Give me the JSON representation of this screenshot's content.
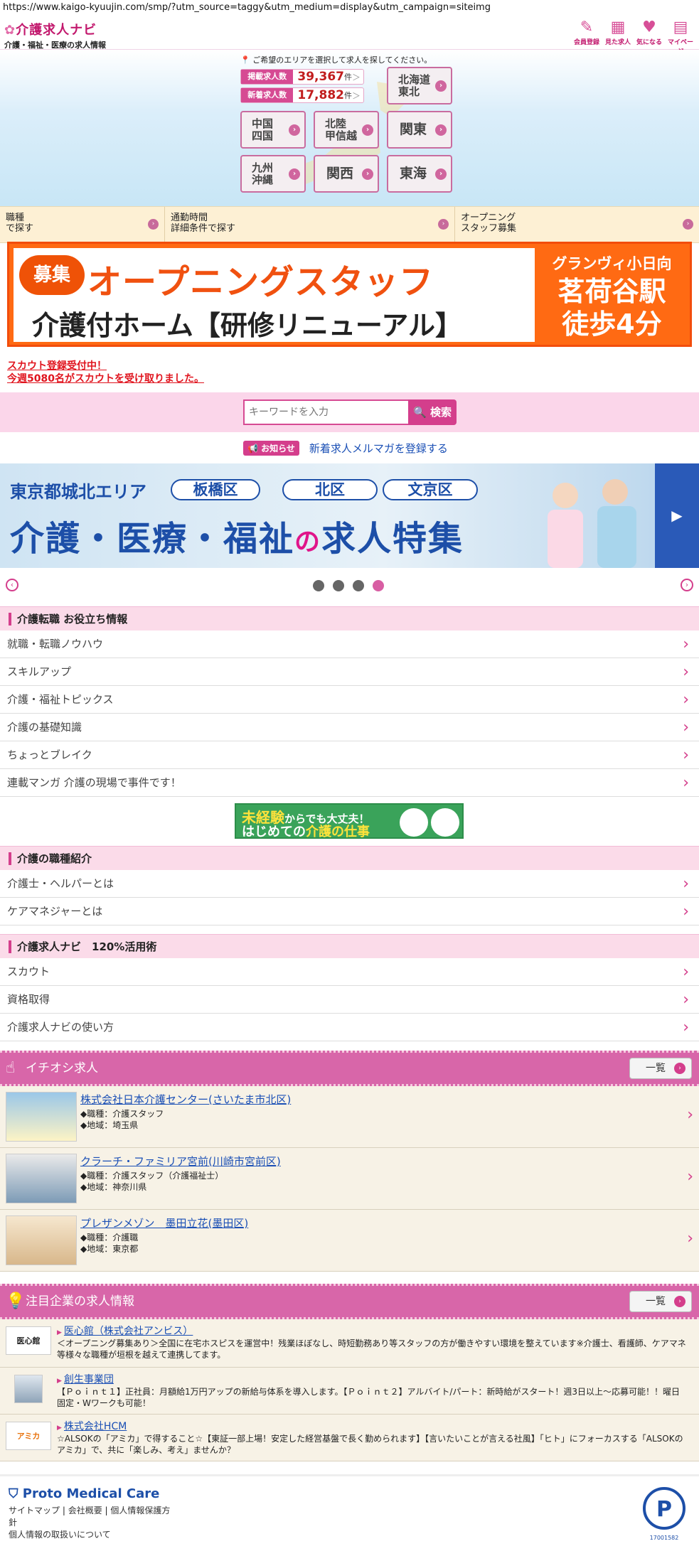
{
  "url": "https://www.kaigo-kyuujin.com/smp/?utm_source=taggy&utm_medium=display&utm_campaign=siteimg",
  "header": {
    "logo_title": "介護求人ナビ",
    "logo_sub": "介護・福祉・医療の求人情報",
    "nav": [
      {
        "label": "会員登録",
        "icon": "pencil-icon"
      },
      {
        "label": "見た求人",
        "icon": "calendar-icon"
      },
      {
        "label": "気になる",
        "icon": "heart-icon"
      },
      {
        "label": "マイページ",
        "icon": "mypage-icon"
      }
    ]
  },
  "area": {
    "message": "ご希望のエリアを選択して求人を探してください。",
    "stats": [
      {
        "label": "掲載求人数",
        "value": "39,367",
        "unit": "件"
      },
      {
        "label": "新着求人数",
        "value": "17,882",
        "unit": "件"
      }
    ],
    "regions": [
      "北海道\n東北",
      "中国\n四国",
      "北陸\n甲信越",
      "関東",
      "九州\n沖縄",
      "関西",
      "東海"
    ]
  },
  "search_options": [
    "職種\nで探す",
    "通勤時間\n詳細条件で探す",
    "オープニング\nスタッフ募集"
  ],
  "banner1": {
    "badge": "募集",
    "line1": "オープニングスタッフ",
    "line2": "介護付ホーム【研修リニューアル】",
    "side1": "グランヴィ小日向",
    "side2": "茗荷谷駅",
    "side3": "徒歩4分"
  },
  "scout": {
    "line1": "スカウト登録受付中！",
    "line2": "今週5080名がスカウトを受け取りました。"
  },
  "keyword": {
    "placeholder": "キーワードを入力",
    "button": "検索"
  },
  "notice": {
    "tag": "お知らせ",
    "link": "新着求人メルマガを登録する"
  },
  "banner2": {
    "area": "東京都城北エリア",
    "tags": [
      "板橋区",
      "北区",
      "文京区"
    ],
    "title_a": "介護・医療・福祉",
    "title_b": "の",
    "title_c": "求人特集"
  },
  "colors": {
    "brand": "#d43e8c",
    "header_pink": "#d866a9",
    "link": "#1a4fb5"
  },
  "section1": {
    "title": "介護転職 お役立ち情報",
    "items": [
      "就職・転職ノウハウ",
      "スキルアップ",
      "介護・福祉トピックス",
      "介護の基礎知識",
      "ちょっとブレイク",
      "連載マンガ 介護の現場で事件です！"
    ]
  },
  "mini_banner": {
    "a": "未経験",
    "a2": "からでも大丈夫！",
    "b": "はじめての",
    "b2": "介護の仕事"
  },
  "section2": {
    "title": "介護の職種紹介",
    "items": [
      "介護士・ヘルパーとは",
      "ケアマネジャーとは"
    ]
  },
  "section3": {
    "title": "介護求人ナビ　120%活用術",
    "items": [
      "スカウト",
      "資格取得",
      "介護求人ナビの使い方"
    ]
  },
  "pickup": {
    "title": "イチオシ求人",
    "all": "一覧",
    "jobs": [
      {
        "name": "株式会社日本介護センター(さいたま市北区)",
        "type": "◆職種：介護スタッフ",
        "area": "◆地域：埼玉県"
      },
      {
        "name": "クラーチ・ファミリア宮前(川崎市宮前区)",
        "type": "◆職種：介護スタッフ（介護福祉士）",
        "area": "◆地域：神奈川県"
      },
      {
        "name": "プレザンメゾン　墨田立花(墨田区)",
        "type": "◆職種：介護職",
        "area": "◆地域：東京都"
      }
    ]
  },
  "featured": {
    "title": "注目企業の求人情報",
    "all": "一覧",
    "companies": [
      {
        "name": "医心館（株式会社アンビス）",
        "logo": "医心館",
        "text": "＜オープニング募集あり＞全国に在宅ホスピスを運営中！残業ほぼなし、時短勤務あり等スタッフの方が働きやすい環境を整えています※介護士、看護師、ケアマネ等様々な職種が垣根を越えて連携してます。"
      },
      {
        "name": "創生事業団",
        "logo": "",
        "text": "【Ｐｏｉｎｔ１】正社員：月額給1万円アップの新給与体系を導入します。【Ｐｏｉｎｔ２】アルバイト/パート：新時給がスタート！週3日以上～応募可能！！曜日固定・Wワークも可能！"
      },
      {
        "name": "株式会社HCM",
        "logo": "アミカ",
        "text": "☆ALSOKの「アミカ」で得すること☆【東証一部上場！安定した経営基盤で長く勤められます】【言いたいことが言える社風】「ヒト」にフォーカスする「ALSOKのアミカ」で、共に「楽しみ、考え」ませんか？"
      }
    ]
  },
  "footer": {
    "brand": "Proto Medical Care",
    "links": [
      "サイトマップ",
      "会社概要",
      "個人情報保護方針",
      "個人情報の取扱いについて"
    ],
    "privacy_number": "17001582"
  }
}
